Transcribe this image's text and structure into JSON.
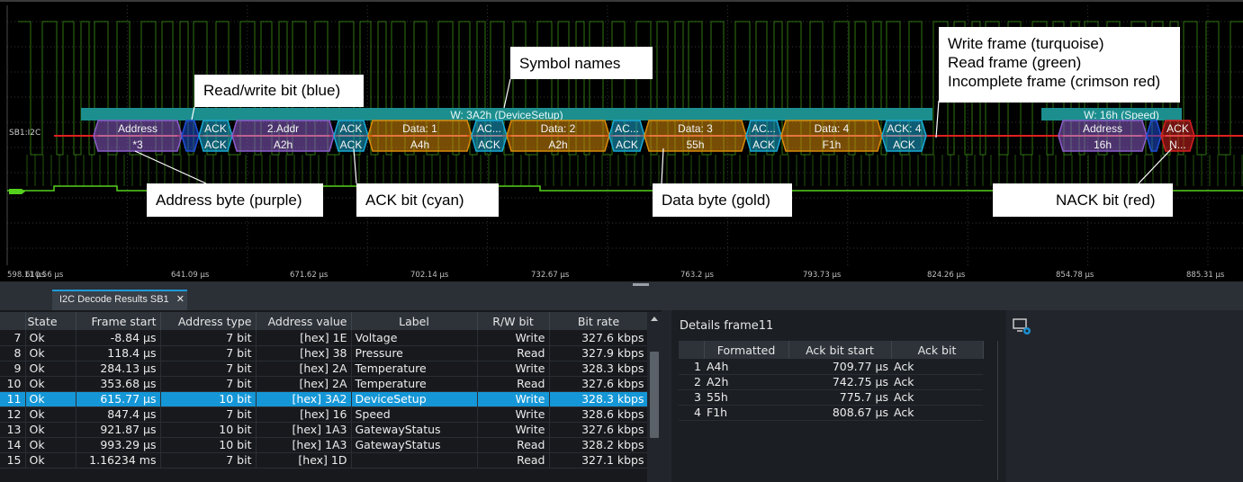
{
  "scope": {
    "channel_label": "SB1:I2C",
    "time_ticks": [
      "598.11 µs",
      "610.56 µs",
      "641.09 µs",
      "671.62 µs",
      "702.14 µs",
      "732.67 µs",
      "763.2 µs",
      "793.73 µs",
      "824.26 µs",
      "854.78 µs",
      "885.31 µs"
    ],
    "frame1_label": "W: 3A2h (DeviceSetup)",
    "frame2_label": "W: 16h (Speed)",
    "symbols_top": [
      "Address",
      "ACK",
      "2.Addr",
      "ACK",
      "Data: 1",
      "AC...",
      "Data: 2",
      "AC...",
      "Data: 3",
      "AC...",
      "Data: 4",
      "ACK: 4"
    ],
    "symbols_bottom": [
      "*3",
      "ACK",
      "A2h",
      "ACK",
      "A4h",
      "ACK",
      "A2h",
      "ACK",
      "55h",
      "ACK",
      "F1h",
      "ACK"
    ],
    "symbols2_top": [
      "Address",
      "ACK"
    ],
    "symbols2_bottom": [
      "16h",
      "N..."
    ],
    "colors": {
      "frame_write": "#1c8e8e",
      "address": "#8a5cc8",
      "rw_bit": "#1f4fd6",
      "ack": "#19a9d4",
      "data": "#d88a0a",
      "nack": "#d42020",
      "signal": "#55d11d",
      "trigger": "#e02020"
    }
  },
  "callouts": {
    "symbol_names": "Symbol names",
    "read_write_bit": "Read/write bit (blue)",
    "address_byte": "Address byte (purple)",
    "ack_bit": "ACK bit (cyan)",
    "data_byte": "Data byte (gold)",
    "nack_bit": "NACK bit (red)",
    "frame_legend": [
      "Write frame (turquoise)",
      "Read frame (green)",
      "Incomplete frame (crimson red)"
    ]
  },
  "results_tab": {
    "title": "I2C Decode Results SB1",
    "close": "✕"
  },
  "results": {
    "columns": [
      "State",
      "Frame start",
      "Address type",
      "Address value",
      "Label",
      "R/W bit",
      "Bit rate"
    ],
    "rows": [
      {
        "idx": "7",
        "state": "Ok",
        "start": "-8.84 µs",
        "atype": "7 bit",
        "avalue": "[hex] 1E",
        "label": "Voltage",
        "rw": "Write",
        "rate": "327.6 kbps"
      },
      {
        "idx": "8",
        "state": "Ok",
        "start": "118.4 µs",
        "atype": "7 bit",
        "avalue": "[hex] 38",
        "label": "Pressure",
        "rw": "Read",
        "rate": "327.9 kbps"
      },
      {
        "idx": "9",
        "state": "Ok",
        "start": "284.13 µs",
        "atype": "7 bit",
        "avalue": "[hex] 2A",
        "label": "Temperature",
        "rw": "Write",
        "rate": "328.3 kbps"
      },
      {
        "idx": "10",
        "state": "Ok",
        "start": "353.68 µs",
        "atype": "7 bit",
        "avalue": "[hex] 2A",
        "label": "Temperature",
        "rw": "Read",
        "rate": "327.6 kbps"
      },
      {
        "idx": "11",
        "state": "Ok",
        "start": "615.77 µs",
        "atype": "10 bit",
        "avalue": "[hex] 3A2",
        "label": "DeviceSetup",
        "rw": "Write",
        "rate": "328.3 kbps"
      },
      {
        "idx": "12",
        "state": "Ok",
        "start": "847.4 µs",
        "atype": "7 bit",
        "avalue": "[hex] 16",
        "label": "Speed",
        "rw": "Write",
        "rate": "328.6 kbps"
      },
      {
        "idx": "13",
        "state": "Ok",
        "start": "921.87 µs",
        "atype": "10 bit",
        "avalue": "[hex] 1A3",
        "label": "GatewayStatus",
        "rw": "Write",
        "rate": "327.6 kbps"
      },
      {
        "idx": "14",
        "state": "Ok",
        "start": "993.29 µs",
        "atype": "10 bit",
        "avalue": "[hex] 1A3",
        "label": "GatewayStatus",
        "rw": "Read",
        "rate": "328.2 kbps"
      },
      {
        "idx": "15",
        "state": "Ok",
        "start": "1.16234 ms",
        "atype": "7 bit",
        "avalue": "[hex] 1D",
        "label": "",
        "rw": "Read",
        "rate": "327.1 kbps"
      }
    ],
    "selected_row": "11"
  },
  "details": {
    "title": "Details frame11",
    "columns": [
      "Formatted",
      "Ack bit start",
      "Ack bit"
    ],
    "rows": [
      {
        "idx": "1",
        "formatted": "A4h",
        "start": "709.77 µs",
        "ack": "Ack"
      },
      {
        "idx": "2",
        "formatted": "A2h",
        "start": "742.75 µs",
        "ack": "Ack"
      },
      {
        "idx": "3",
        "formatted": "55h",
        "start": "775.7 µs",
        "ack": "Ack"
      },
      {
        "idx": "4",
        "formatted": "F1h",
        "start": "808.67 µs",
        "ack": "Ack"
      }
    ]
  },
  "icons": {
    "close": "close-icon",
    "settings": "display-settings-icon",
    "scroll_up": "chevron-up-icon"
  }
}
